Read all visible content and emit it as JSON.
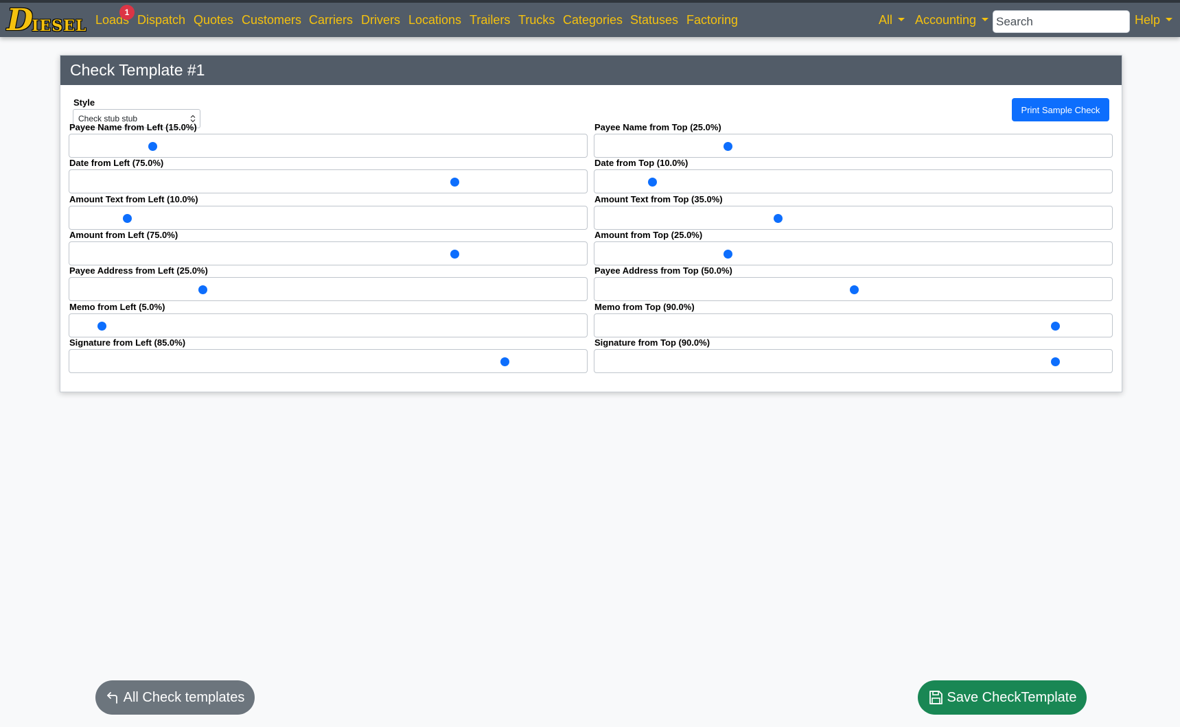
{
  "navbar": {
    "brand_initial": "D",
    "brand_rest": "IESEL",
    "loads_badge": "1",
    "links": [
      "Loads",
      "Dispatch",
      "Quotes",
      "Customers",
      "Carriers",
      "Drivers",
      "Locations",
      "Trailers",
      "Trucks",
      "Categories",
      "Statuses",
      "Factoring"
    ],
    "all_label": "All",
    "accounting_label": "Accounting",
    "help_label": "Help",
    "search_placeholder": "Search"
  },
  "card": {
    "title": "Check Template #1",
    "style_label": "Style",
    "style_value": "Check stub stub",
    "print_button": "Print Sample Check"
  },
  "fields": [
    {
      "left_label": "Payee Name from Left (15.0%)",
      "left_value": 15.0,
      "top_label": "Payee Name from Top (25.0%)",
      "top_value": 25.0
    },
    {
      "left_label": "Date from Left (75.0%)",
      "left_value": 75.0,
      "top_label": "Date from Top (10.0%)",
      "top_value": 10.0
    },
    {
      "left_label": "Amount Text from Left (10.0%)",
      "left_value": 10.0,
      "top_label": "Amount Text from Top (35.0%)",
      "top_value": 35.0
    },
    {
      "left_label": "Amount from Left (75.0%)",
      "left_value": 75.0,
      "top_label": "Amount from Top (25.0%)",
      "top_value": 25.0
    },
    {
      "left_label": "Payee Address from Left (25.0%)",
      "left_value": 25.0,
      "top_label": "Payee Address from Top (50.0%)",
      "top_value": 50.0
    },
    {
      "left_label": "Memo from Left (5.0%)",
      "left_value": 5.0,
      "top_label": "Memo from Top (90.0%)",
      "top_value": 90.0
    },
    {
      "left_label": "Signature from Left (85.0%)",
      "left_value": 85.0,
      "top_label": "Signature from Top (90.0%)",
      "top_value": 90.0
    }
  ],
  "footer": {
    "back_button": "All Check templates",
    "save_button": "Save CheckTemplate"
  },
  "icons": {
    "back": "return-arrow-icon",
    "save": "floppy-disk-icon"
  },
  "colors": {
    "navbar": "#525c68",
    "nav_text": "#f4c10f",
    "primary": "#0d6efd",
    "success": "#198754",
    "secondary": "#6c757d",
    "badge": "#dc3545"
  }
}
